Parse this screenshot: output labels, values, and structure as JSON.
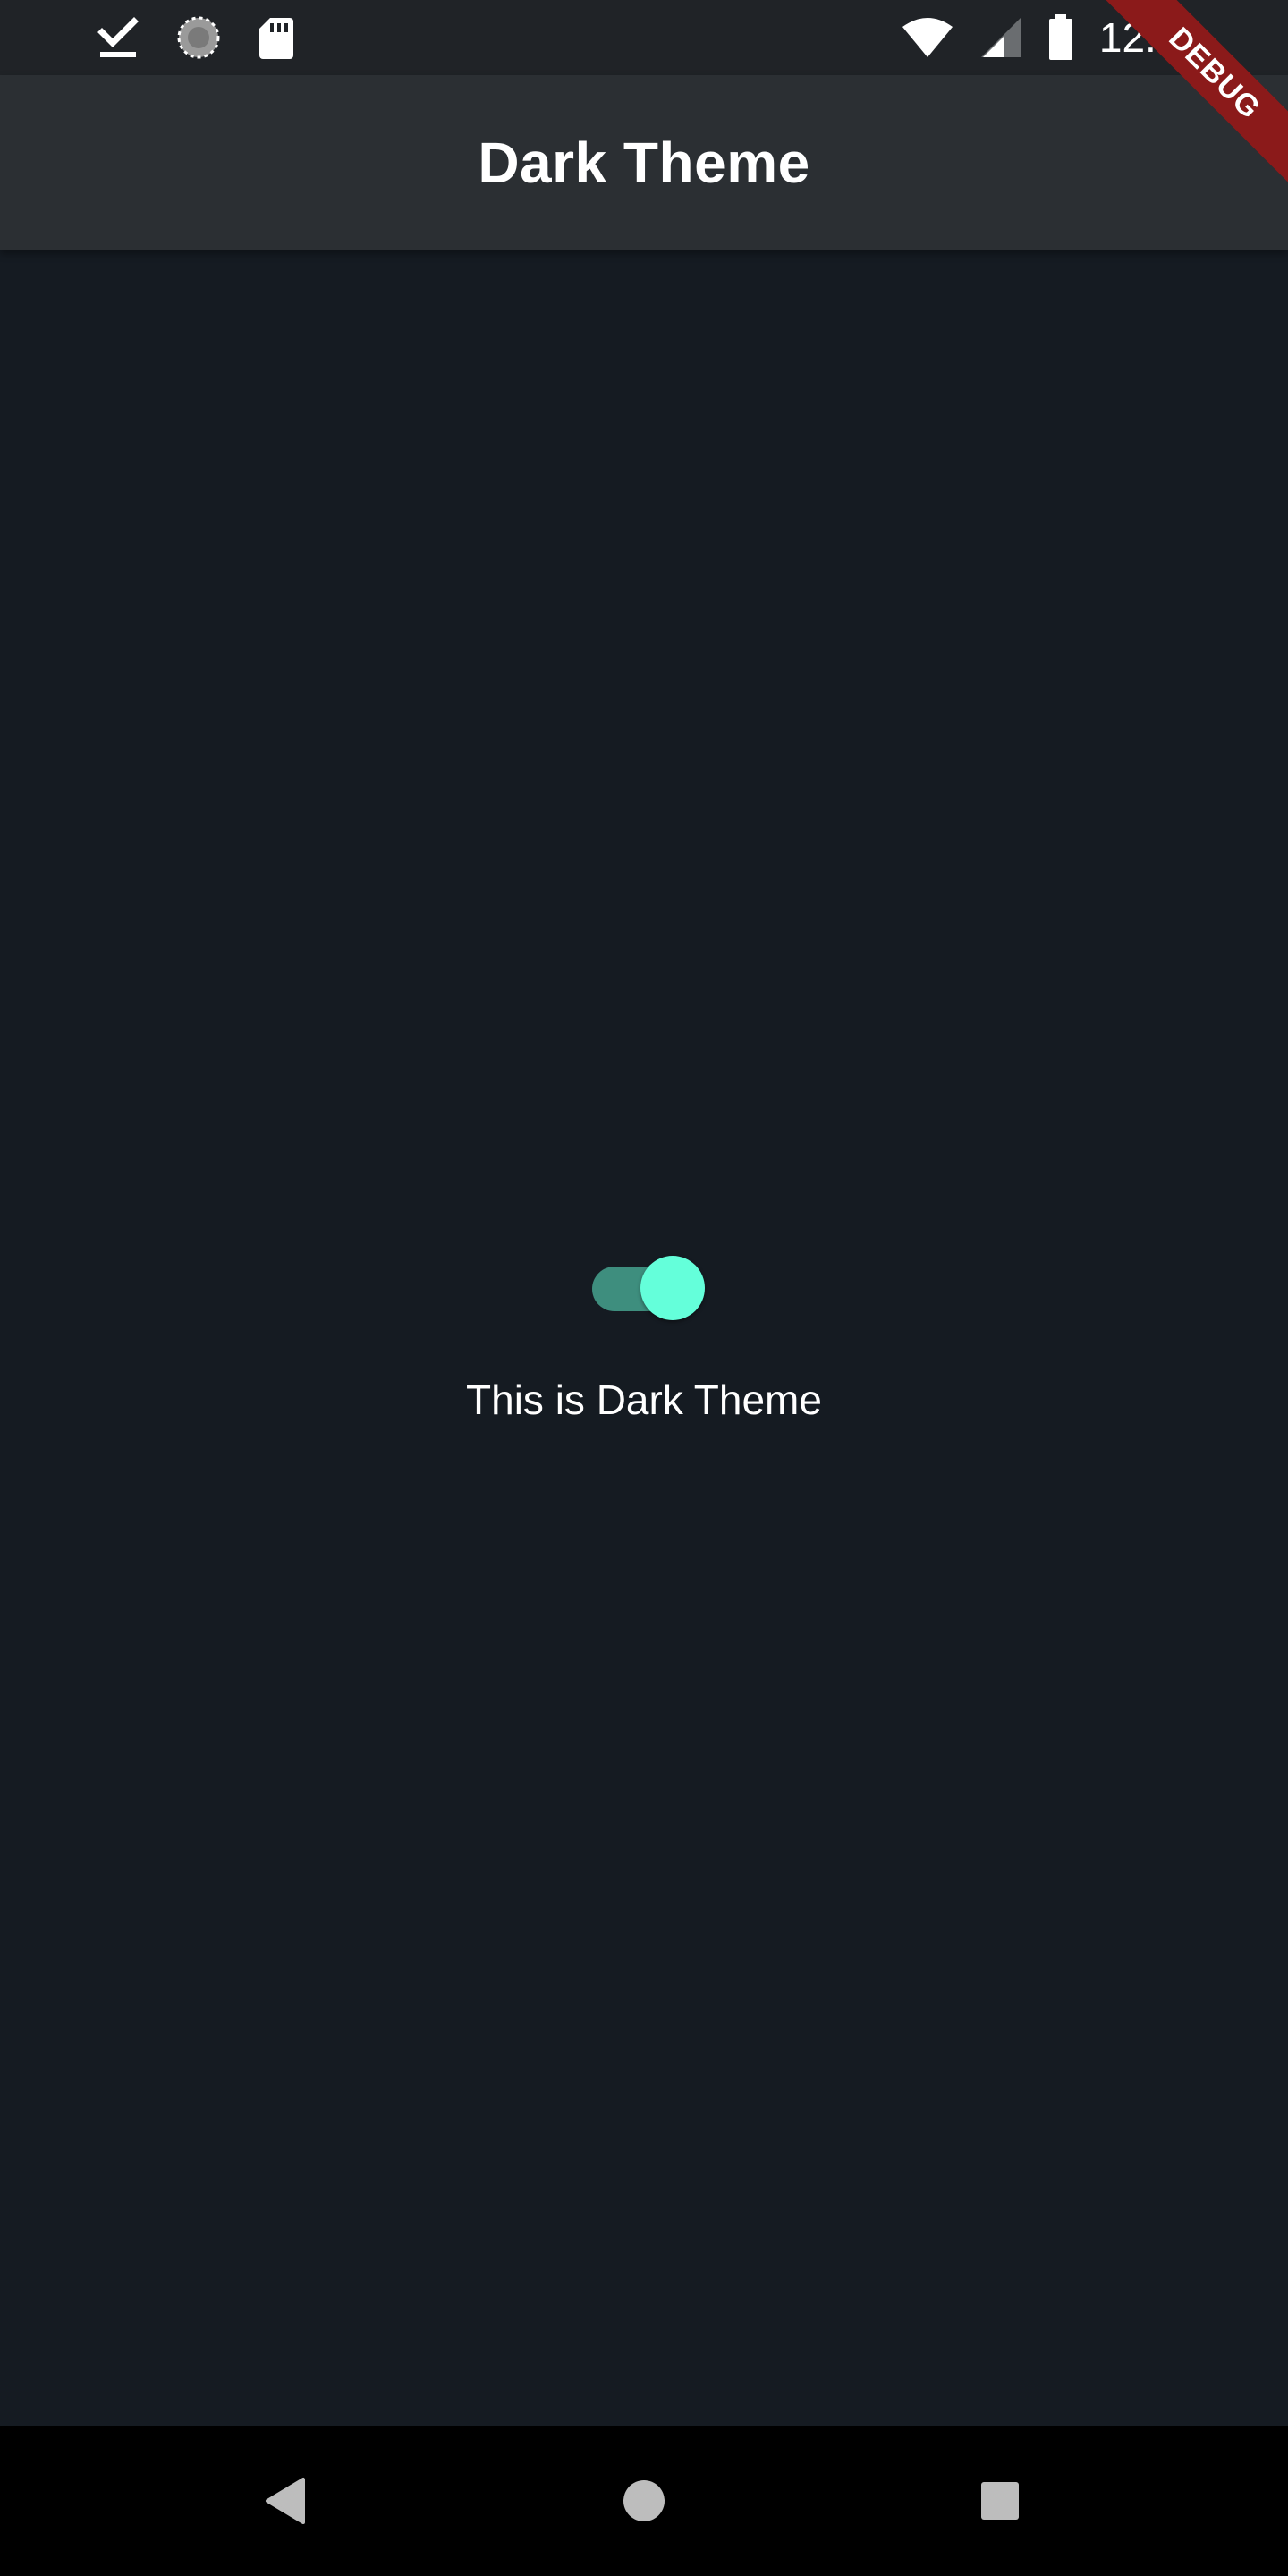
{
  "status_bar": {
    "time": "12:46",
    "left_icons": [
      "download-done-icon",
      "sync-progress-icon",
      "sd-card-icon"
    ],
    "right_icons": [
      "wifi-icon",
      "cell-signal-icon",
      "battery-icon"
    ]
  },
  "app_bar": {
    "title": "Dark Theme"
  },
  "main": {
    "switch_on": true,
    "label": "This is Dark Theme"
  },
  "debug_banner": {
    "label": "DEBUG"
  },
  "nav_bar": {
    "buttons": [
      "back-icon",
      "home-icon",
      "recents-icon"
    ]
  },
  "colors": {
    "background": "#151b22",
    "app_bar": "#2b2f33",
    "status_bar": "#202327",
    "switch_thumb": "#64ffda",
    "switch_track": "#3e8e7e",
    "debug_banner": "#8b1a1a"
  }
}
